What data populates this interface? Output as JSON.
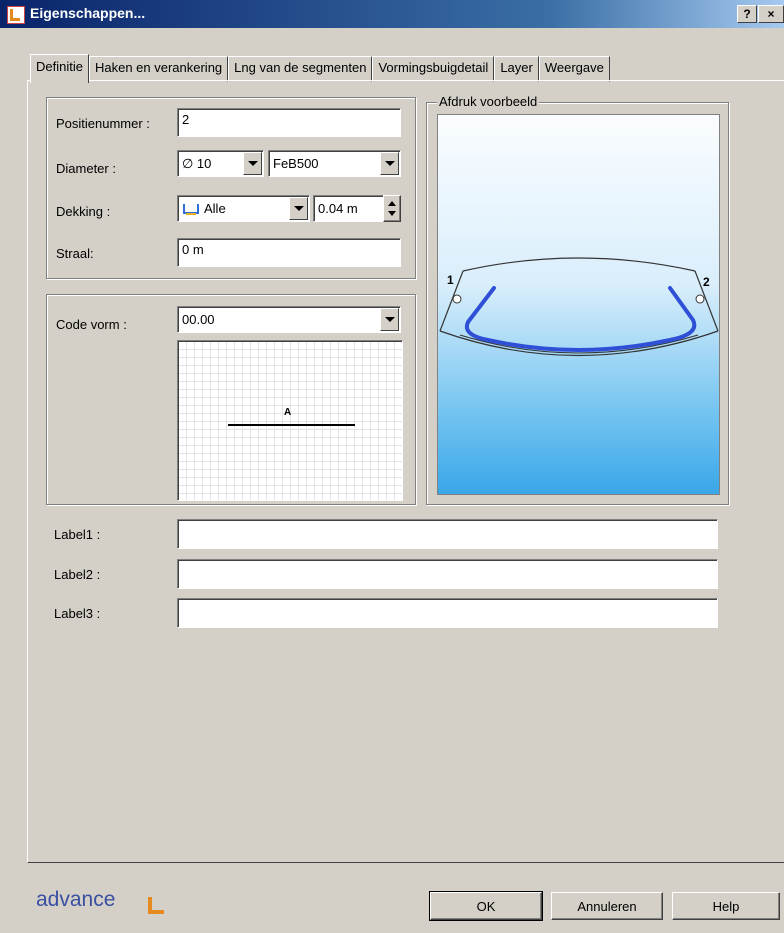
{
  "window": {
    "title": "Eigenschappen...",
    "help_glyph": "?",
    "close_glyph": "×"
  },
  "tabs": [
    {
      "label": "Definitie",
      "active": true
    },
    {
      "label": "Haken en verankering"
    },
    {
      "label": "Lng van de segmenten"
    },
    {
      "label": "Vormingsbuigdetail"
    },
    {
      "label": "Layer"
    },
    {
      "label": "Weergave"
    }
  ],
  "definition": {
    "position_label": "Positienummer :",
    "position_value": "2",
    "diameter_label": "Diameter :",
    "diameter_value": "∅ 10",
    "steel_value": "FeB500",
    "cover_label": "Dekking :",
    "cover_mode_value": "Alle",
    "cover_value": "0.04 m",
    "radius_label": "Straal:",
    "radius_value": "0 m"
  },
  "shape": {
    "code_label": "Code vorm :",
    "code_value": "00.00",
    "segment_label": "A"
  },
  "preview": {
    "group_label": "Afdruk voorbeeld",
    "end1_label": "1",
    "end2_label": "2"
  },
  "labels": [
    {
      "label": "Label1 :",
      "value": ""
    },
    {
      "label": "Label2 :",
      "value": ""
    },
    {
      "label": "Label3 :",
      "value": ""
    }
  ],
  "footer": {
    "brand": "advance",
    "ok_label": "OK",
    "cancel_label": "Annuleren",
    "help_label": "Help"
  },
  "colors": {
    "titlebar": "#0a246a",
    "brand": "#3a4fa3",
    "brand_accent": "#e58a1f",
    "rebar": "#2f4fd6"
  }
}
